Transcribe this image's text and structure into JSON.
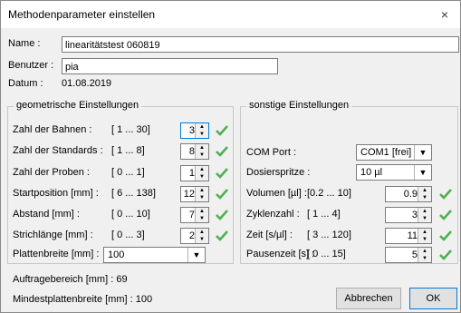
{
  "window": {
    "title": "Methodenparameter einstellen",
    "close_glyph": "×"
  },
  "fields": {
    "name_label": "Name :",
    "name_value": "linearitätstest 060819",
    "benutzer_label": "Benutzer :",
    "benutzer_value": "pia",
    "datum_label": "Datum :",
    "datum_value": "01.08.2019"
  },
  "geo": {
    "title": "geometrische Einstellungen",
    "rows": [
      {
        "label": "Zahl der Bahnen :",
        "range": "[ 1  ...  30]",
        "value": "3"
      },
      {
        "label": "Zahl der Standards :",
        "range": "[ 1  ...   8]",
        "value": "8"
      },
      {
        "label": "Zahl der Proben :",
        "range": "[ 0  ...   1]",
        "value": "1"
      },
      {
        "label": "Startposition [mm] :",
        "range": "[ 6  ... 138]",
        "value": "12"
      },
      {
        "label": "Abstand [mm] :",
        "range": "[ 0  ...  10]",
        "value": "7"
      },
      {
        "label": "Strichlänge [mm] :",
        "range": "[ 0  ...   3]",
        "value": "2"
      }
    ],
    "plattenbreite_label": "Plattenbreite  [mm] :",
    "plattenbreite_value": "100"
  },
  "other": {
    "title": "sonstige Einstellungen",
    "com_label": "COM Port :",
    "com_value": "COM1 [frei]",
    "spritze_label": "Dosierspritze :",
    "spritze_value": "10 µl",
    "rows": [
      {
        "label": "Volumen [µl] :",
        "range": "[0.2   ...  10]",
        "value": "0.9"
      },
      {
        "label": "Zyklenzahl :",
        "range": "[ 1   ...   4]",
        "value": "3"
      },
      {
        "label": "Zeit [s/µl] :",
        "range": "[ 3   ... 120]",
        "value": "11"
      },
      {
        "label": "Pausenzeit [s] :",
        "range": "[ 0   ...  15]",
        "value": "5"
      }
    ]
  },
  "footer": {
    "auftrag": "Auftragebereich [mm] : 69",
    "mindest": "Mindestplattenbreite [mm] : 100",
    "cancel": "Abbrechen",
    "ok": "OK"
  },
  "colors": {
    "check": "#4caf50",
    "focus": "#0078d7"
  },
  "icons": {
    "check": "check-icon",
    "close": "close-icon",
    "spin": "spin-arrows-icon",
    "dropdown": "chevron-down-icon"
  }
}
